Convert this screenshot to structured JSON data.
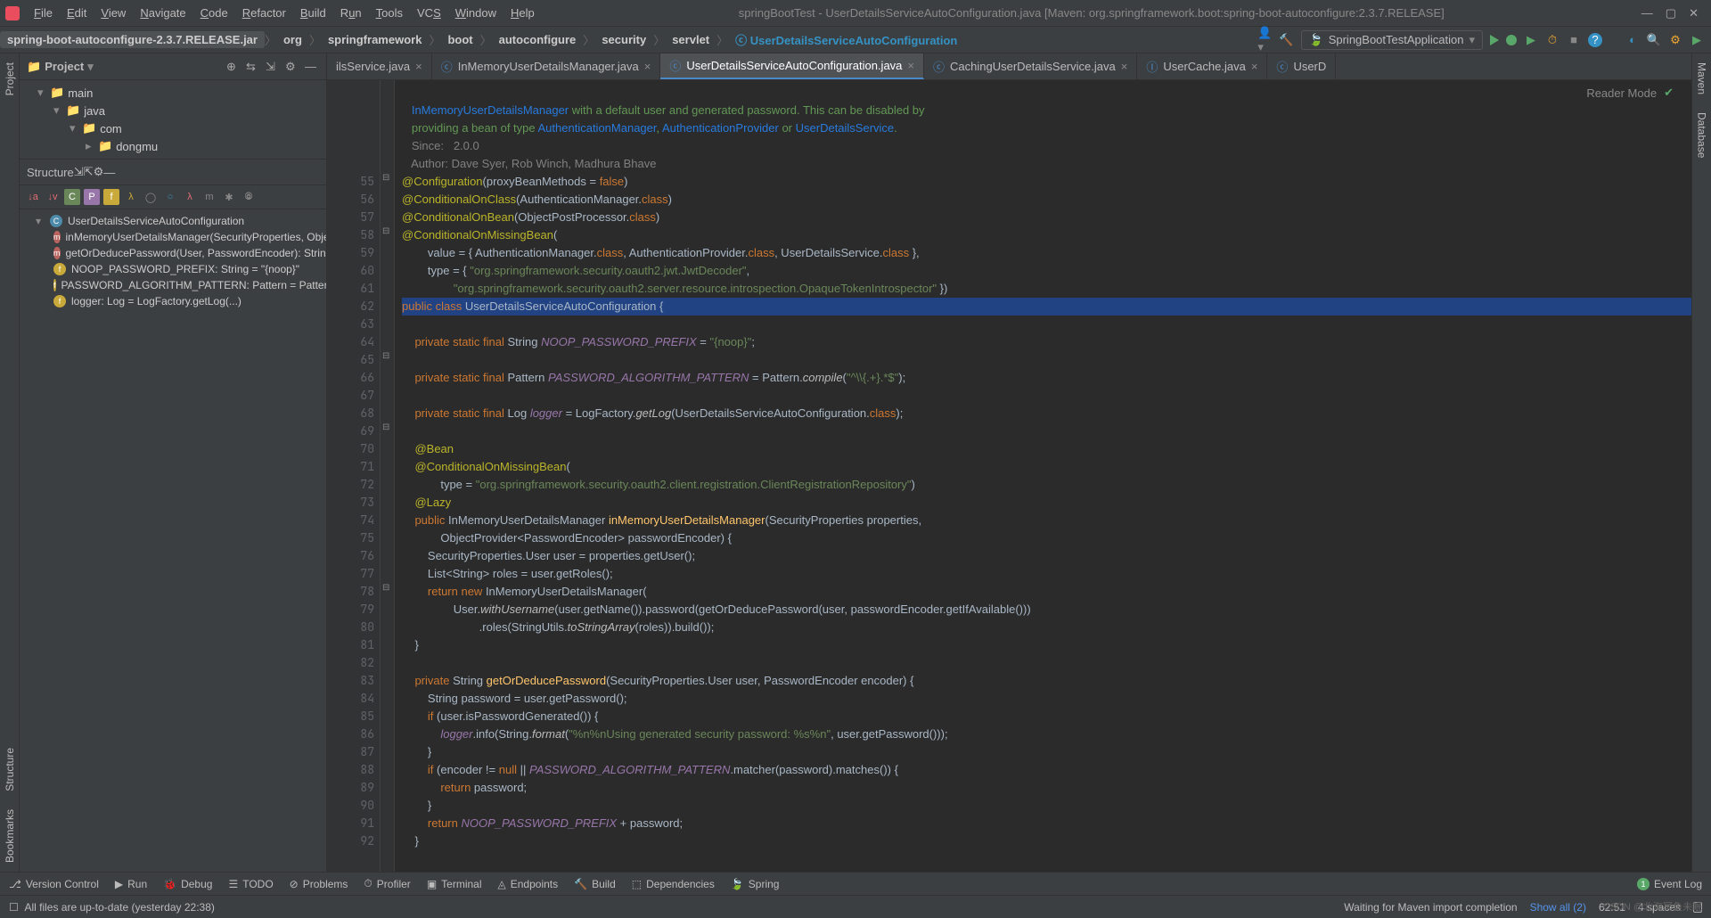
{
  "menu": {
    "items": [
      "File",
      "Edit",
      "View",
      "Navigate",
      "Code",
      "Refactor",
      "Build",
      "Run",
      "Tools",
      "VCS",
      "Window",
      "Help"
    ]
  },
  "window_title": "springBootTest - UserDetailsServiceAutoConfiguration.java [Maven: org.springframework.boot:spring-boot-autoconfigure:2.3.7.RELEASE]",
  "breadcrumb": [
    "spring-boot-autoconfigure-2.3.7.RELEASE.jar",
    "org",
    "springframework",
    "boot",
    "autoconfigure",
    "security",
    "servlet",
    "UserDetailsServiceAutoConfiguration"
  ],
  "run_config": "SpringBootTestApplication",
  "project": {
    "title": "Project",
    "tree": [
      {
        "l": 0,
        "arrow": "▾",
        "icon": "📁",
        "label": "main"
      },
      {
        "l": 1,
        "arrow": "▾",
        "icon": "📁",
        "label": "java"
      },
      {
        "l": 2,
        "arrow": "▾",
        "icon": "📁",
        "label": "com"
      },
      {
        "l": 3,
        "arrow": "▸",
        "icon": "📁",
        "label": "dongmu"
      }
    ]
  },
  "structure": {
    "title": "Structure",
    "root": "UserDetailsServiceAutoConfiguration",
    "members": [
      {
        "k": "m",
        "label": "inMemoryUserDetailsManager(SecurityProperties, ObjectProvider<PasswordEncoder>): InMemoryUserDetailsManager"
      },
      {
        "k": "m",
        "label": "getOrDeducePassword(User, PasswordEncoder): String"
      },
      {
        "k": "f",
        "label": "NOOP_PASSWORD_PREFIX: String = \"{noop}\""
      },
      {
        "k": "f",
        "label": "PASSWORD_ALGORITHM_PATTERN: Pattern = Pattern.compile(\"^\\\\{.+}.*$\")"
      },
      {
        "k": "f",
        "label": "logger: Log = LogFactory.getLog(...)"
      }
    ]
  },
  "editor_tabs": [
    {
      "label": "ilsService.java",
      "active": false
    },
    {
      "label": "InMemoryUserDetailsManager.java",
      "active": false
    },
    {
      "label": "UserDetailsServiceAutoConfiguration.java",
      "active": true
    },
    {
      "label": "CachingUserDetailsService.java",
      "active": false
    },
    {
      "label": "UserCache.java",
      "active": false
    },
    {
      "label": "UserD",
      "active": false
    }
  ],
  "reader_mode": "Reader Mode",
  "doc": {
    "line1a": "InMemoryUserDetailsManager",
    "line1b": " with a default user and generated password. This can be disabled by",
    "line2a": "providing a bean of type ",
    "link1": "AuthenticationManager",
    "comma": ", ",
    "link2": "AuthenticationProvider",
    "or": " or ",
    "link3": "UserDetailsService",
    "dot": ".",
    "since": "Since:",
    "since_v": "2.0.0",
    "author": "Author: ",
    "authors": "Dave Syer, Rob Winch, Madhura Bhave"
  },
  "code": {
    "l55": "@Configuration",
    "l55b": "(proxyBeanMethods = ",
    "l55c": "false",
    "l55d": ")",
    "l56": "@ConditionalOnClass",
    "l56b": "(AuthenticationManager.",
    "l56c": "class",
    "l56d": ")",
    "l57": "@ConditionalOnBean",
    "l57b": "(ObjectPostProcessor.",
    "l57c": "class",
    "l57d": ")",
    "l58": "@ConditionalOnMissingBean",
    "l58b": "(",
    "l59a": "        value = { AuthenticationManager.",
    "l59b": "class",
    "l59c": ", AuthenticationProvider.",
    "l59d": "class",
    "l59e": ", UserDetailsService.",
    "l59f": "class",
    "l59g": " },",
    "l60a": "        type = { ",
    "l60b": "\"org.springframework.security.oauth2.jwt.JwtDecoder\"",
    "l60c": ",",
    "l61a": "                ",
    "l61b": "\"org.springframework.security.oauth2.server.resource.introspection.OpaqueTokenIntrospector\"",
    "l61c": " })",
    "l62a": "public class ",
    "l62b": "UserDetailsServiceAutoConfiguration",
    "l62c": " {",
    "l64a": "    private static final ",
    "l64b": "String ",
    "l64c": "NOOP_PASSWORD_PREFIX",
    "l64d": " = ",
    "l64e": "\"{noop}\"",
    "l64f": ";",
    "l66a": "    private static final ",
    "l66b": "Pattern ",
    "l66c": "PASSWORD_ALGORITHM_PATTERN",
    "l66d": " = Pattern.",
    "l66e": "compile",
    "l66f": "(",
    "l66g": "\"^\\\\{.+}.*$\"",
    "l66h": ");",
    "l68a": "    private static final ",
    "l68b": "Log ",
    "l68c": "logger",
    "l68d": " = LogFactory.",
    "l68e": "getLog",
    "l68f": "(UserDetailsServiceAutoConfiguration.",
    "l68g": "class",
    "l68h": ");",
    "l70": "    @Bean",
    "l71": "    @ConditionalOnMissingBean",
    "l71b": "(",
    "l72a": "            type = ",
    "l72b": "\"org.springframework.security.oauth2.client.registration.ClientRegistrationRepository\"",
    "l72c": ")",
    "l73": "    @Lazy",
    "l74a": "    public ",
    "l74b": "InMemoryUserDetailsManager ",
    "l74c": "inMemoryUserDetailsManager",
    "l74d": "(SecurityProperties properties,",
    "l75": "            ObjectProvider<PasswordEncoder> passwordEncoder) {",
    "l76": "        SecurityProperties.User user = properties.getUser();",
    "l77": "        List<String> roles = user.getRoles();",
    "l78a": "        return new ",
    "l78b": "InMemoryUserDetailsManager(",
    "l79a": "                User.",
    "l79b": "withUsername",
    "l79c": "(user.getName()).password(getOrDeducePassword(user, passwordEncoder.getIfAvailable()))",
    "l80a": "                        .roles(StringUtils.",
    "l80b": "toStringArray",
    "l80c": "(roles)).build());",
    "l81": "    }",
    "l83a": "    private ",
    "l83b": "String ",
    "l83c": "getOrDeducePassword",
    "l83d": "(SecurityProperties.User user, PasswordEncoder encoder) {",
    "l84": "        String password = user.getPassword();",
    "l85a": "        if ",
    "l85b": "(user.isPasswordGenerated()) {",
    "l86a": "            ",
    "l86b": "logger",
    "l86c": ".info(String.",
    "l86d": "format",
    "l86e": "(",
    "l86f": "\"%n%nUsing generated security password: %s%n\"",
    "l86g": ", user.getPassword()));",
    "l87": "        }",
    "l88a": "        if ",
    "l88b": "(encoder != ",
    "l88c": "null",
    "l88d": " || ",
    "l88e": "PASSWORD_ALGORITHM_PATTERN",
    "l88f": ".matcher(password).matches()) {",
    "l89a": "            return ",
    "l89b": "password;",
    "l90": "        }",
    "l91a": "        return ",
    "l91b": "NOOP_PASSWORD_PREFIX",
    "l91c": " + password;",
    "l92": "    }"
  },
  "line_numbers": [
    55,
    56,
    57,
    58,
    59,
    60,
    61,
    62,
    63,
    64,
    65,
    66,
    67,
    68,
    69,
    70,
    71,
    72,
    73,
    74,
    75,
    76,
    77,
    78,
    79,
    80,
    81,
    82,
    83,
    84,
    85,
    86,
    87,
    88,
    89,
    90,
    91,
    92
  ],
  "bottom_tools": [
    "Version Control",
    "Run",
    "Debug",
    "TODO",
    "Problems",
    "Profiler",
    "Terminal",
    "Endpoints",
    "Build",
    "Dependencies",
    "Spring"
  ],
  "event_log": "Event Log",
  "status_left": "All files are up-to-date (yesterday 22:38)",
  "status_mid": "Waiting for Maven import completion",
  "status_showall": "Show all (2)",
  "status_pos": "62:51",
  "status_indent": "4 spaces",
  "left_tabs": [
    "Project",
    "Structure",
    "Bookmarks"
  ],
  "right_tabs": [
    "Maven",
    "Database"
  ],
  "watermark": "CSDN @北海冥鱼未眠"
}
